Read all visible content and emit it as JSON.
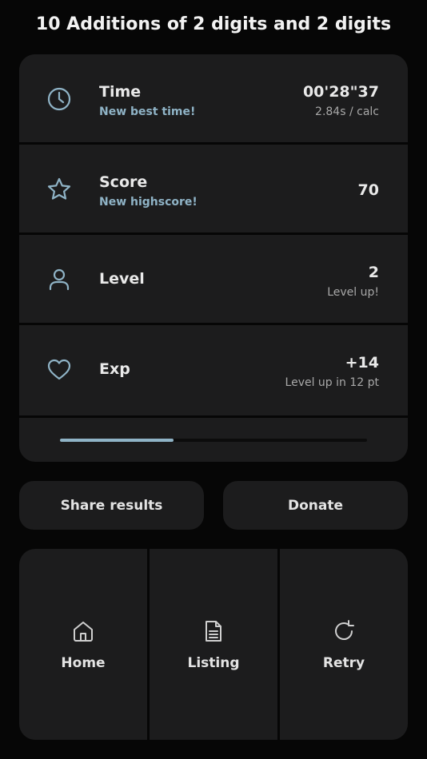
{
  "header": {
    "title": "10 Additions of 2 digits and 2 digits"
  },
  "results": {
    "time": {
      "label": "Time",
      "sub": "New best time!",
      "value": "00'28\"37",
      "detail": "2.84s / calc",
      "icon": "clock-icon"
    },
    "score": {
      "label": "Score",
      "sub": "New highscore!",
      "value": "70",
      "icon": "star-icon"
    },
    "level": {
      "label": "Level",
      "value": "2",
      "detail": "Level up!",
      "icon": "user-icon"
    },
    "exp": {
      "label": "Exp",
      "value": "+14",
      "detail": "Level up in 12 pt",
      "icon": "heart-icon"
    },
    "progress": {
      "fraction": 0.37
    }
  },
  "actions": {
    "share_label": "Share results",
    "donate_label": "Donate"
  },
  "nav": {
    "items": [
      {
        "label": "Home",
        "icon": "home-icon"
      },
      {
        "label": "Listing",
        "icon": "document-icon"
      },
      {
        "label": "Retry",
        "icon": "refresh-icon"
      }
    ]
  },
  "colors": {
    "accent": "#8fb3c6",
    "card": "#1c1c1d",
    "background": "#060606"
  }
}
